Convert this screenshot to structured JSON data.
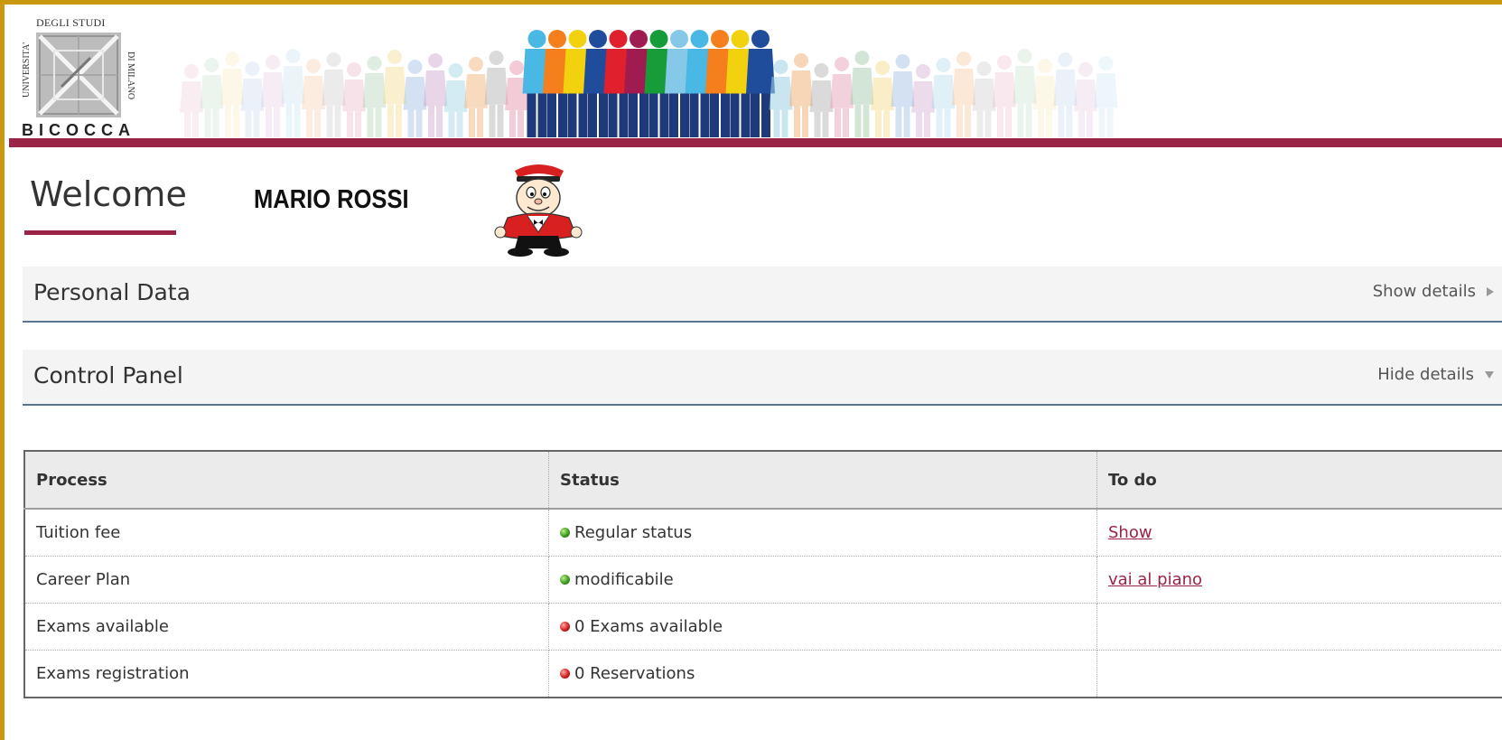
{
  "logo": {
    "top_text": "DEGLI STUDI",
    "left_text": "UNIVERSITA'",
    "right_text": "DI MILANO",
    "bottom_text": "BICOCCA"
  },
  "colors": {
    "brand": "#9b2345",
    "frame": "#c9980e",
    "status_ok": "#3c9b1e",
    "status_ko": "#d21f1f",
    "panel_border": "#5b7590"
  },
  "welcome": {
    "title": "Welcome",
    "user_name": "MARIO ROSSI"
  },
  "panels": {
    "personal": {
      "title": "Personal Data",
      "toggle": "Show details",
      "toggle_icon": "triangle-right-icon"
    },
    "control": {
      "title": "Control Panel",
      "toggle": "Hide details",
      "toggle_icon": "triangle-down-icon"
    }
  },
  "table": {
    "headers": {
      "process": "Process",
      "status": "Status",
      "todo": "To do"
    },
    "rows": [
      {
        "process": "Tuition fee",
        "status": "Regular status",
        "status_icon": "green-dot-icon",
        "todo": "Show"
      },
      {
        "process": "Career Plan",
        "status": "modificabile",
        "status_icon": "green-dot-icon",
        "todo": "vai al piano"
      },
      {
        "process": "Exams available",
        "status": "0 Exams available",
        "status_icon": "red-dot-icon",
        "todo": ""
      },
      {
        "process": "Exams registration",
        "status": "0 Reservations",
        "status_icon": "red-dot-icon",
        "todo": ""
      }
    ]
  }
}
